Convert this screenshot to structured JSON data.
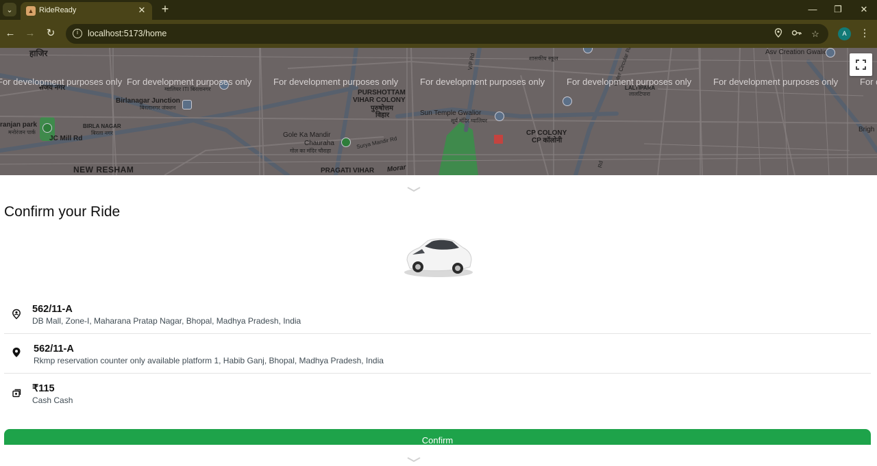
{
  "browser": {
    "tab_title": "RideReady",
    "url": "localhost:5173/home",
    "profile_initial": "A"
  },
  "map": {
    "watermark": "For development purposes only",
    "labels": {
      "haziri": "हाजिर",
      "sanjay_nagar_en": "संजय नगर",
      "birlanagar_junction": "Birlanagar Junction",
      "birlanagar_junction_hi": "बिरलानगर जंक्शन",
      "iti": "ग्वालियर ITI बिरलानगर",
      "ranjan_park": "ranjan park",
      "ranjan_park_hi": "मनोरंजन पार्क",
      "birla_nagar": "BIRLA NAGAR",
      "birla_nagar_hi": "बिरला नगर",
      "jc_mill_rd": "JC Mill Rd",
      "new_resham": "NEW RESHAM",
      "purshottam": "PURSHOTTAM",
      "vihar_colony": "VIHAR COLONY",
      "purshottam_hi": "पुरुषोत्तम",
      "vihar_hi": "विहार",
      "gole_ka_mandir": "Gole Ka Mandir",
      "chauraha": "Chauraha",
      "gole_hi": "गोल का मंदिर चौराहा",
      "surya_mandir_rd": "Surya Mandir Rd",
      "pragati_vihar": "PRAGATI VIHAR",
      "morar": "Morar",
      "sun_temple": "Sun Temple Gwalior",
      "sun_temple_hi": "सूर्य मंदिर ग्वालियर",
      "vip_rd": "VIP Rd",
      "govt_school": "शासकीय स्कूल",
      "cp_colony": "CP COLONY",
      "cp_colony_hi": "CP कॉलोनी",
      "laltipara": "LALTIPARA",
      "laltipara_hi": "लालटिपारा",
      "outer_circular": "Outer Circular Rd",
      "asv_creation": "Asv Creation Gwalior",
      "bright": "Brigh",
      "rd": "Rd"
    }
  },
  "panel": {
    "title": "Confirm your Ride",
    "pickup": {
      "main": "562/11-A",
      "sub": "DB Mall, Zone-I, Maharana Pratap Nagar, Bhopal, Madhya Pradesh, India"
    },
    "destination": {
      "main": "562/11-A",
      "sub": "Rkmp reservation counter only available platform 1, Habib Ganj, Bhopal, Madhya Pradesh, India"
    },
    "payment": {
      "main": "₹115",
      "sub": "Cash Cash"
    },
    "confirm_label": "Confirm"
  },
  "colors": {
    "accent": "#1ea34a",
    "chrome_dark": "#2b2a0f",
    "chrome_toolbar": "#4a4418"
  }
}
